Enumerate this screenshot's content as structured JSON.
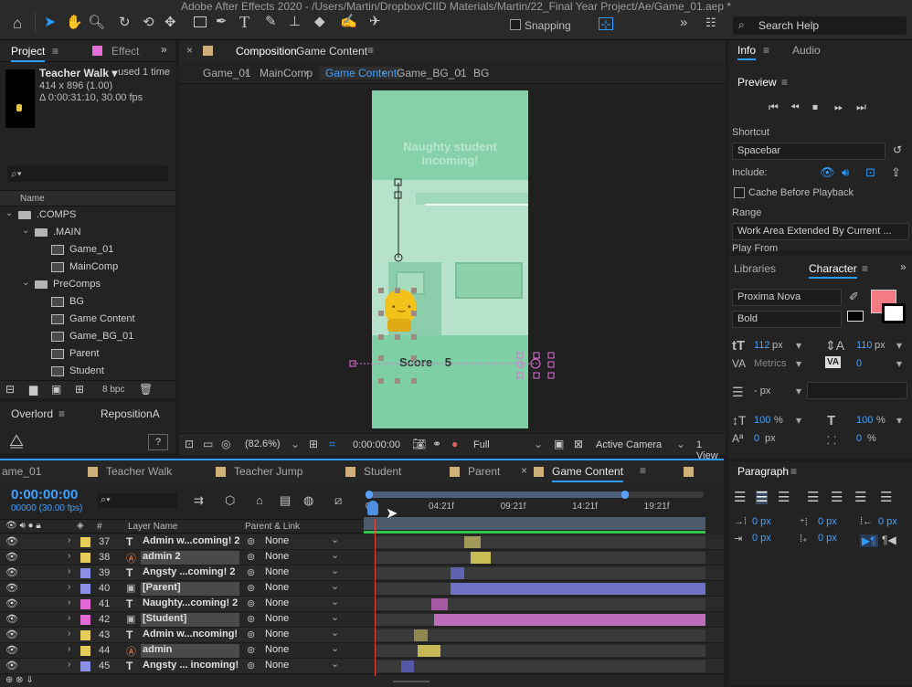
{
  "window_title": "Adobe After Effects 2020 - /Users/Martin/Dropbox/CIID Materials/Martin/22_Final Year Project/Ae/Game_01.aep *",
  "toolbar": {
    "snapping_label": "Snapping",
    "search_placeholder": "Search Help"
  },
  "project_panel": {
    "tab_project": "Project",
    "tab_effect": "Effect",
    "item_name": "Teacher Walk ▾",
    "item_used": ", used 1 time",
    "item_dims": "414 x 896 (1.00)",
    "item_duration": "Δ 0:00:31:10, 30.00 fps",
    "column_name": "Name",
    "tree": [
      {
        "label": ".COMPS",
        "type": "folder",
        "level": 0
      },
      {
        "label": ".MAIN",
        "type": "folder",
        "level": 1
      },
      {
        "label": "Game_01",
        "type": "comp",
        "level": 2
      },
      {
        "label": "MainComp",
        "type": "comp",
        "level": 2
      },
      {
        "label": "PreComps",
        "type": "folder",
        "level": 1
      },
      {
        "label": "BG",
        "type": "comp",
        "level": 2
      },
      {
        "label": "Game Content",
        "type": "comp",
        "level": 2
      },
      {
        "label": "Game_BG_01",
        "type": "comp",
        "level": 2
      },
      {
        "label": "Parent",
        "type": "comp",
        "level": 2
      },
      {
        "label": "Student",
        "type": "comp",
        "level": 2
      }
    ],
    "bpc": "8 bpc"
  },
  "lower_left": {
    "tab1": "Overlord",
    "tab2": "RepositionA",
    "help": "?"
  },
  "composition": {
    "tab_prefix": "Composition",
    "tab_name": "Game Content",
    "breadcrumbs": [
      "Game_01",
      "MainComp",
      "Game Content",
      "Game_BG_01",
      "BG"
    ],
    "canvas_title_line1": "Naughty student",
    "canvas_title_line2": "incoming!",
    "score_label": "Score",
    "score_value": "5",
    "zoom": "(82.6%)",
    "timecode": "0:00:00:00",
    "resolution": "Full",
    "camera": "Active Camera",
    "views": "1 View"
  },
  "info_panel": {
    "tab_info": "Info",
    "tab_audio": "Audio",
    "preview_title": "Preview",
    "shortcut_label": "Shortcut",
    "shortcut_value": "Spacebar",
    "include_label": "Include:",
    "cache_label": "Cache Before Playback",
    "range_label": "Range",
    "range_value": "Work Area Extended By Current ...",
    "play_from": "Play From"
  },
  "character_panel": {
    "tab_libraries": "Libraries",
    "tab_character": "Character",
    "font": "Proxima Nova",
    "style": "Bold",
    "font_size": "112",
    "font_size_unit": "px",
    "leading": "110",
    "leading_unit": "px",
    "kerning": "Metrics",
    "tracking": "0",
    "stroke": "- px",
    "vscale": "100",
    "hscale": "100",
    "pct": "%",
    "baseline": "0",
    "baseline_unit": "px",
    "tsume": "0",
    "tsume_unit": "%",
    "fill_color": "#f47a84"
  },
  "paragraph_panel": {
    "title": "Paragraph",
    "indents": [
      "0 px",
      "0 px",
      "0 px",
      "0 px",
      "0 px"
    ]
  },
  "timeline": {
    "tabs": [
      "ame_01",
      "Teacher Walk",
      "Teacher Jump",
      "Student",
      "Parent",
      "Game Content"
    ],
    "tab_colors": [
      "#e8d36a",
      "#cdb07a",
      "#cdb07a",
      "#cdb07a",
      "#cdb07a",
      "#cdb07a"
    ],
    "timecode": "0:00:00:00",
    "fps": "00000 (30.00 fps)",
    "ruler": [
      "0f",
      "04:21f",
      "09:21f",
      "14:21f",
      "19:21f"
    ],
    "col_layer_name": "Layer Name",
    "col_parent": "Parent & Link",
    "col_num": "#",
    "layers": [
      {
        "num": "37",
        "type": "T",
        "name": "Admin w...coming! 2",
        "color": "#e6cd5a",
        "parent": "None",
        "bar_start": 0.27,
        "bar_end": 0.32,
        "bar_color": "#a29a5a"
      },
      {
        "num": "38",
        "type": "img",
        "name": "admin 2",
        "color": "#e6cd5a",
        "parent": "None",
        "bar_start": 0.29,
        "bar_end": 0.35,
        "bar_color": "#c9bd55"
      },
      {
        "num": "39",
        "type": "T",
        "name": "Angsty ...coming! 2",
        "color": "#8b8fe8",
        "parent": "None",
        "bar_start": 0.23,
        "bar_end": 0.27,
        "bar_color": "#5e63b0"
      },
      {
        "num": "40",
        "type": "comp",
        "name": "[Parent]",
        "color": "#8b8fe8",
        "parent": "None",
        "bar_start": 0.23,
        "bar_end": 1.0,
        "bar_color": "#6d72c6"
      },
      {
        "num": "41",
        "type": "T",
        "name": "Naughty...coming! 2",
        "color": "#e26ad7",
        "parent": "None",
        "bar_start": 0.17,
        "bar_end": 0.22,
        "bar_color": "#a45aa2"
      },
      {
        "num": "42",
        "type": "comp",
        "name": "[Student]",
        "color": "#e26ad7",
        "parent": "None",
        "bar_start": 0.18,
        "bar_end": 1.0,
        "bar_color": "#bd6cb9"
      },
      {
        "num": "43",
        "type": "T",
        "name": "Admin w...ncoming!",
        "color": "#e6cd5a",
        "parent": "None",
        "bar_start": 0.12,
        "bar_end": 0.16,
        "bar_color": "#8e8850"
      },
      {
        "num": "44",
        "type": "img",
        "name": "admin",
        "color": "#e6cd5a",
        "parent": "None",
        "bar_start": 0.13,
        "bar_end": 0.2,
        "bar_color": "#c6b955"
      },
      {
        "num": "45",
        "type": "T",
        "name": "Angsty ... incoming!",
        "color": "#8b8fe8",
        "parent": "None",
        "bar_start": 0.08,
        "bar_end": 0.12,
        "bar_color": "#5458a6"
      }
    ]
  },
  "colors": {
    "accent": "#2b9bff",
    "canvas_green": "#7fcfa6",
    "canvas_light": "#b8e3cc",
    "playhead": "#e8463a"
  },
  "icons": [
    "home-icon",
    "selection-tool-icon",
    "hand-tool-icon",
    "zoom-tool-icon",
    "rotate-tool-icon",
    "camera-orbit-icon",
    "rectangle-tool-icon",
    "pen-tool-icon",
    "type-tool-icon",
    "brush-tool-icon",
    "clone-stamp-icon",
    "eraser-icon",
    "puppet-pin-icon",
    "search-icon",
    "folder-icon",
    "comp-icon",
    "eye-icon",
    "lock-icon",
    "trash-icon"
  ]
}
